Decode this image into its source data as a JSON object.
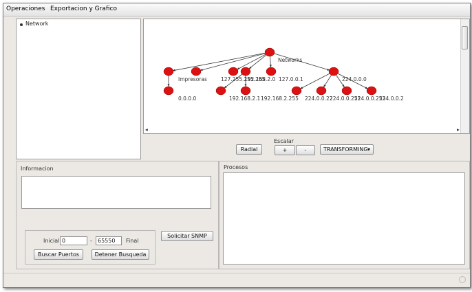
{
  "menu": [
    "Operaciones",
    "Exportacion y Grafico"
  ],
  "tree": {
    "root_label": "Network"
  },
  "graph": {
    "hub": {
      "label": "Networks"
    },
    "branches": [
      {
        "label": "",
        "child": "0.0.0.0"
      },
      {
        "label": "Impresoras",
        "child": null
      },
      {
        "label": "127.255.255.255",
        "child": null
      },
      {
        "label": "192.168.2.0",
        "children": [
          "192.168.2.1",
          "192.168.2.255"
        ]
      },
      {
        "label": "127.0.0.1",
        "child": null
      },
      {
        "label": "224.0.0.0",
        "children": [
          "224.0.0.22",
          "224.0.0.251",
          "224.0.0.253",
          "224.0.0.2"
        ]
      }
    ],
    "colors": {
      "node": "#dd1111",
      "edge": "#333333"
    }
  },
  "controls": {
    "escalar_label": "Escalar",
    "radial_button": "Radial",
    "plus_button": "+",
    "minus_button": "-",
    "mode_select": "TRANSFORMING"
  },
  "informacion": {
    "title": "Informacion"
  },
  "procesos": {
    "title": "Procesos"
  },
  "ports": {
    "inicial_label": "Inicial",
    "inicial_value": "0",
    "dash": "-",
    "final_value": "65550",
    "final_label": "Final",
    "buscar_button": "Buscar Puertos",
    "detener_button": "Detener Busqueda",
    "snmp_button": "Solicitar SNMP"
  }
}
